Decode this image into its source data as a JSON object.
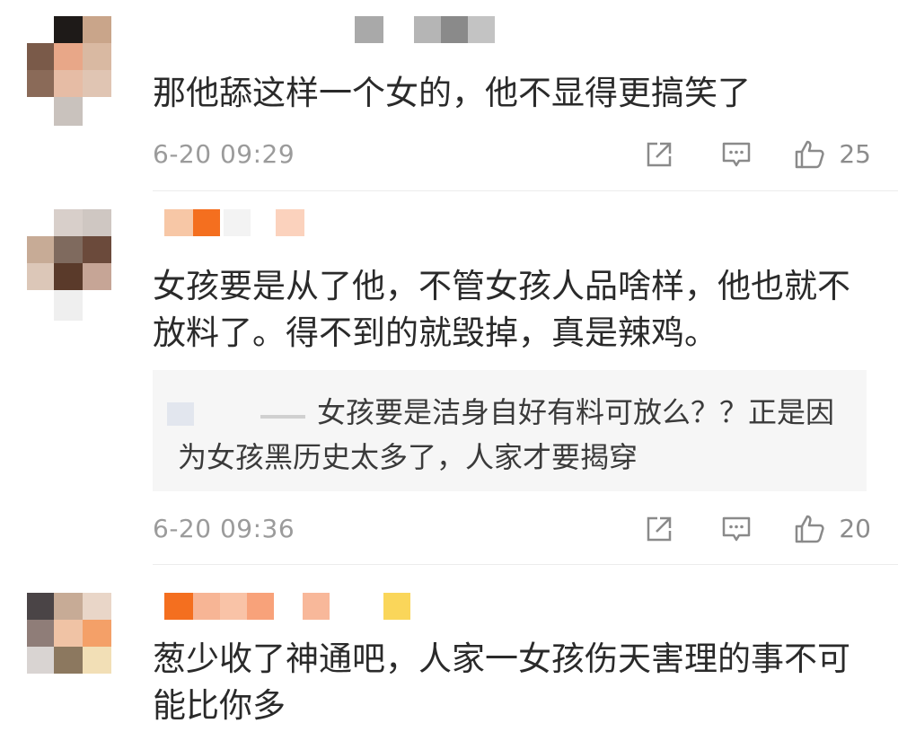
{
  "comments": [
    {
      "text": "那他舔这样一个女的，他不显得更搞笑了",
      "time": "6-20 09:29",
      "likes": "25",
      "name_colors": [
        "#a9a9a9",
        "#b5b5b5",
        "#8a8a8a",
        "#c3c3c3"
      ]
    },
    {
      "text": "女孩要是从了他，不管女孩人品啥样，他也就不放料了。得不到的就毁掉，真是辣鸡。",
      "reply": {
        "text": "女孩要是洁身自好有料可放么？？正是因为女孩黑历史太多了，人家才要揭穿"
      },
      "time": "6-20 09:36",
      "likes": "20",
      "name_colors": [
        "#f7c7a6",
        "#f46f1f",
        "#f3f3f3",
        "#fbd2bd"
      ]
    },
    {
      "text": "葱少收了神通吧，人家一女孩伤天害理的事不可能比你多",
      "name_colors": [
        "#f46f1f",
        "#f7b595",
        "#f9c3a7",
        "#f8a27a",
        "#f8b89a",
        "#fad65a"
      ]
    }
  ],
  "icons": {
    "share": "share-icon",
    "reply": "comment-icon",
    "like": "thumbs-up-icon"
  },
  "colors": {
    "time_text": "#9b9b9b",
    "reply_bg": "#f6f6f6",
    "divider": "#ececec"
  }
}
